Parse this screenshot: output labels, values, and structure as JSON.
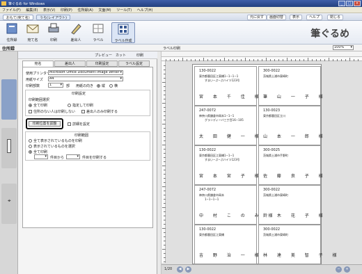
{
  "window": {
    "title": "筆ぐるめ for Windows"
  },
  "menu": [
    "ファイル(F)",
    "編集(E)",
    "表示(V)",
    "印刷(P)",
    "住所録(A)",
    "文面(M)",
    "ツール(T)",
    "ヘルプ(H)"
  ],
  "top_tabs": [
    "おもて(宛て名)",
    "うら(レイアウト)"
  ],
  "top_buttons": [
    "元に戻す",
    "画面切替",
    "表示",
    "ヘルプ",
    "閉じる"
  ],
  "ribbon": {
    "buttons": [
      "住所録",
      "宛て名",
      "印刷",
      "差出人",
      "ラベル",
      "ラベル作成"
    ],
    "logo": "筆ぐるめ"
  },
  "work": {
    "title": "住所録",
    "doc_title": "ラベル印刷",
    "zoom": "100%"
  },
  "panel": {
    "toolbar": [
      "プレビュー",
      "カット",
      "印刷"
    ],
    "tabs": [
      "宛名",
      "差出人",
      "印刷設定",
      "ラベル設定"
    ],
    "printer_label": "使用プリンター",
    "printer_value": "Microsoft Office Document Image Writer",
    "paper_label": "用紙サイズ",
    "paper_value": "A4",
    "copies_label": "印刷部数",
    "copies_value": "1",
    "copies_unit": "部",
    "direction_label": "用紙の向き",
    "direction_options": [
      "縦",
      "横"
    ],
    "print_settings_title": "印刷設定",
    "range_title": "印刷範囲選択",
    "range_options": [
      "全て印刷",
      "指定して印刷"
    ],
    "check_options": [
      "住所のない人は印刷しない",
      "差出人のみ印刷する"
    ],
    "highlight_button": "印刷位置を調整",
    "other_button": "詳細を設定",
    "range2_title": "印刷範囲",
    "range2_options": [
      "全て表示されているものを印刷",
      "表示されているものを選択",
      "全て印刷"
    ],
    "from_label": "件目から",
    "to_label": "件目を印刷する"
  },
  "labels": [
    {
      "zip": "130-0022",
      "addr1": "東京都墨田区江東橋1−1−1−1",
      "addr2": "すまい−ぷ−ぷハイツ123号",
      "name": "宮 本 千 佳 様"
    },
    {
      "zip": "300-0022",
      "addr1": "茨城県土浦市東崎町",
      "addr2": "",
      "name": "筆 山 一 子 様"
    },
    {
      "zip": "247-0072",
      "addr1": "神奈川県鎌倉市岡本1−1−1",
      "addr2": "グランディーバ三丁目16−105",
      "name": "太 田 健 一 様"
    },
    {
      "zip": "130-0023",
      "addr1": "東京都墨田区立川",
      "addr2": "",
      "name": "山 本 一 郎 様"
    },
    {
      "zip": "130-0022",
      "addr1": "東京都墨田区江東橋1−1−1",
      "addr2": "すまい−ぷ−ぷハイツ123号",
      "name": "宮 本 宮 子 様"
    },
    {
      "zip": "300-0025",
      "addr1": "茨城県土浦市手野町",
      "addr2": "",
      "name": "佐 藤 良 子 様"
    },
    {
      "zip": "247-0072",
      "addr1": "神奈川県鎌倉市岡本",
      "addr2": "1−1−1−1",
      "name": "中 村 こ の み 様"
    },
    {
      "zip": "300-0022",
      "addr1": "茨城県土浦市東崎町",
      "addr2": "",
      "name": "鈴 木 花 子 様"
    },
    {
      "zip": "130-0022",
      "addr1": "東京都墨田区江東橋",
      "addr2": "",
      "name": "吉 野 治 一 様"
    },
    {
      "zip": "300-0022",
      "addr1": "茨城県土浦市東崎町",
      "addr2": "",
      "name": "林 達 美 智 子 様"
    }
  ],
  "status": {
    "page": "1/20"
  }
}
